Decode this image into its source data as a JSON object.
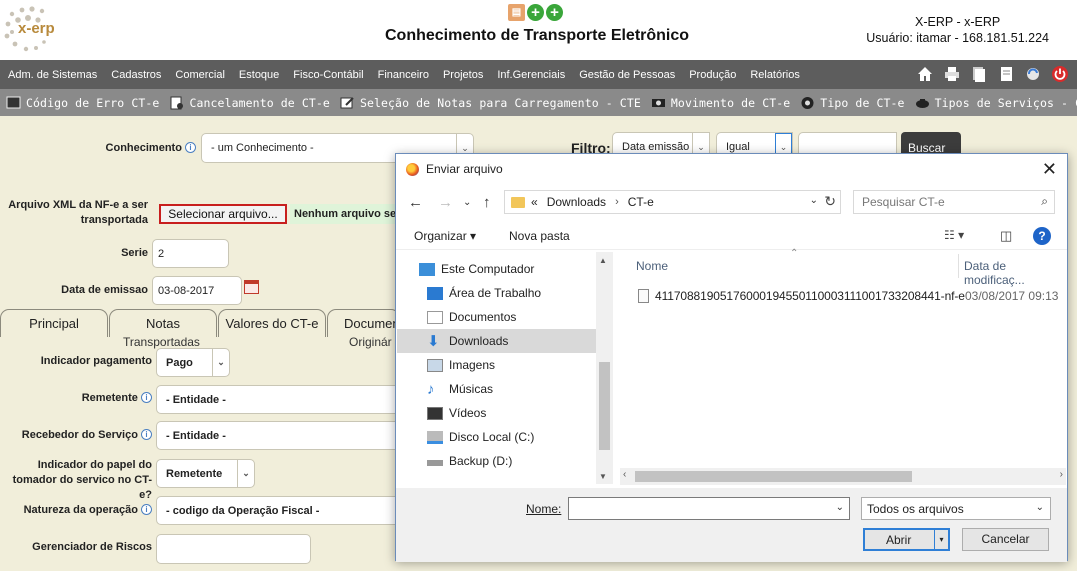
{
  "header": {
    "logo_text": "x-erp",
    "page_title": "Conhecimento de Transporte Eletrônico",
    "user_line1": "X-ERP - x-ERP",
    "user_line2": "Usuário: itamar - 168.181.51.224"
  },
  "menu": {
    "items": [
      "Adm. de Sistemas",
      "Cadastros",
      "Comercial",
      "Estoque",
      "Fisco-Contábil",
      "Financeiro",
      "Projetos",
      "Inf.Gerenciais",
      "Gestão de Pessoas",
      "Produção",
      "Relatórios"
    ],
    "icons": [
      "home-icon",
      "printer-icon",
      "documents-icon",
      "page-icon",
      "refresh-icon",
      "power-icon"
    ]
  },
  "subbar": {
    "items": [
      "Código de Erro CT-e",
      "Cancelamento de CT-e",
      "Seleção de Notas para Carregamento - CTE",
      "Movimento de CT-e",
      "Tipo de CT-e",
      "Tipos de Serviços - CTE"
    ]
  },
  "form": {
    "conhecimento_label": "Conhecimento",
    "conhecimento_value": "- um Conhecimento -",
    "filtro_label": "Filtro:",
    "filtro_field": "Data emissão",
    "filtro_op": "Igual",
    "buscar_label": "Buscar",
    "xml_label_1": "Arquivo XML da NF-e a ser",
    "xml_label_2": "transportada",
    "file_button": "Selecionar arquivo...",
    "file_status": "Nenhum arquivo selecionado",
    "serie_label": "Serie",
    "serie_value": "2",
    "data_label": "Data de emissao",
    "data_value": "03-08-2017",
    "tabs": [
      "Principal",
      "Notas",
      "Valores do CT-e",
      "Documen"
    ],
    "tab_subs": [
      "Transportadas",
      "Originár"
    ],
    "indicador_pag_label": "Indicador pagamento",
    "indicador_pag_value": "Pago",
    "remetente_label": "Remetente",
    "remetente_value": "- Entidade -",
    "recebedor_label": "Recebedor do Serviço",
    "recebedor_value": "- Entidade -",
    "papel_label_1": "Indicador do papel do",
    "papel_label_2": "tomador do servico no CT-e?",
    "papel_value": "Remetente",
    "natureza_label": "Natureza da operação",
    "natureza_value": "- codigo da Operação Fiscal -",
    "gerenciador_label": "Gerenciador de Riscos",
    "gerenciador_value": ""
  },
  "dialog": {
    "title": "Enviar arquivo",
    "breadcrumb": [
      "Downloads",
      "CT-e"
    ],
    "breadcrumb_prefix": "«",
    "search_placeholder": "Pesquisar CT-e",
    "organize_label": "Organizar",
    "new_folder_label": "Nova pasta",
    "nav_items": [
      {
        "label": "Este Computador",
        "icon": "computer-icon"
      },
      {
        "label": "Área de Trabalho",
        "icon": "desktop-icon"
      },
      {
        "label": "Documentos",
        "icon": "documents-icon"
      },
      {
        "label": "Downloads",
        "icon": "download-icon"
      },
      {
        "label": "Imagens",
        "icon": "images-icon"
      },
      {
        "label": "Músicas",
        "icon": "music-icon"
      },
      {
        "label": "Vídeos",
        "icon": "videos-icon"
      },
      {
        "label": "Disco Local (C:)",
        "icon": "local-disk-icon"
      },
      {
        "label": "Backup (D:)",
        "icon": "drive-icon"
      }
    ],
    "selected_nav": "Downloads",
    "col_name": "Nome",
    "col_date": "Data de modificaç...",
    "files": [
      {
        "name": "41170881905176000194550110003111001733208441-nf-e",
        "date": "03/08/2017 09:13"
      }
    ],
    "name_label": "Nome:",
    "name_value": "",
    "type_value": "Todos os arquivos",
    "open_label": "Abrir",
    "cancel_label": "Cancelar",
    "colors": {
      "accent": "#2f7fd6",
      "selection": "#d9d9d9"
    }
  }
}
